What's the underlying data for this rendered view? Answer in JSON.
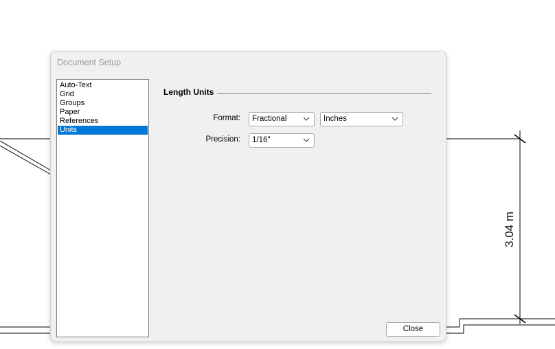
{
  "drawing": {
    "dimension_label": "3.04 m"
  },
  "dialog": {
    "title": "Document Setup",
    "categories": [
      {
        "label": "Auto-Text",
        "selected": false
      },
      {
        "label": "Grid",
        "selected": false
      },
      {
        "label": "Groups",
        "selected": false
      },
      {
        "label": "Paper",
        "selected": false
      },
      {
        "label": "References",
        "selected": false
      },
      {
        "label": "Units",
        "selected": true
      }
    ],
    "section_title": "Length Units",
    "format": {
      "label": "Format:",
      "value": "Fractional",
      "unit_value": "Inches"
    },
    "precision": {
      "label": "Precision:",
      "value": "1/16\""
    },
    "close_label": "Close"
  },
  "colors": {
    "selection": "#0078d7",
    "dialog_bg": "#f0f0f0"
  }
}
